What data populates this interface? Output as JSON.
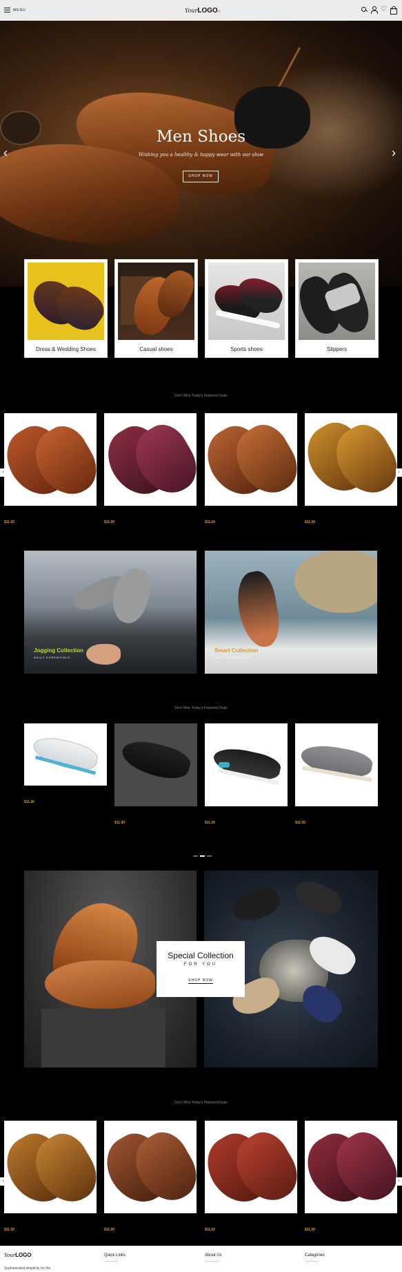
{
  "header": {
    "menu_label": "MENU",
    "logo_script": "Your",
    "logo_bold": "LOGO",
    "logo_mark": "®"
  },
  "hero": {
    "title": "Men Shoes",
    "subtitle": "Wishing you a healthy & happy wear with our shoe",
    "button": "SHOP NOW",
    "prev_icon": "‹",
    "next_icon": "›"
  },
  "categories": [
    {
      "label": "Dress & Wedding Shoes"
    },
    {
      "label": "Casual shoes"
    },
    {
      "label": "Sports shoes"
    },
    {
      "label": "Slippers"
    }
  ],
  "featured1": {
    "title": "Don't Miss Today's Featured Deals",
    "prices": [
      "$11.00",
      "$11.00",
      "$11.00",
      "$11.00"
    ]
  },
  "banners": [
    {
      "title": "Jogging Collection",
      "sub": "DAILY ESSENTIALS"
    },
    {
      "title": "Smart Collection",
      "sub": "DAILY ESSENTIALS"
    }
  ],
  "featured2": {
    "title": "Don't Miss Today's Featured Deals",
    "prices": [
      "$11.00",
      "$11.00",
      "$11.00",
      "$11.00"
    ]
  },
  "special": {
    "title": "Special Collection",
    "sub": "FOR YOU",
    "button": "SHOP NOW"
  },
  "featured3": {
    "title": "Don't Miss Today's Featured Deals",
    "prices": [
      "$11.00",
      "$11.00",
      "$11.00",
      "$11.00"
    ]
  },
  "footer": {
    "logo_script": "Your",
    "logo_bold": "LOGO",
    "tagline": "Sophisticated simplicity for the",
    "col1": "Quick Links",
    "col2": "About Us",
    "col3": "Categories"
  },
  "colors": {
    "accent": "#e0a020",
    "banner_title": "#b7e02a",
    "page_bg": "#000000"
  }
}
